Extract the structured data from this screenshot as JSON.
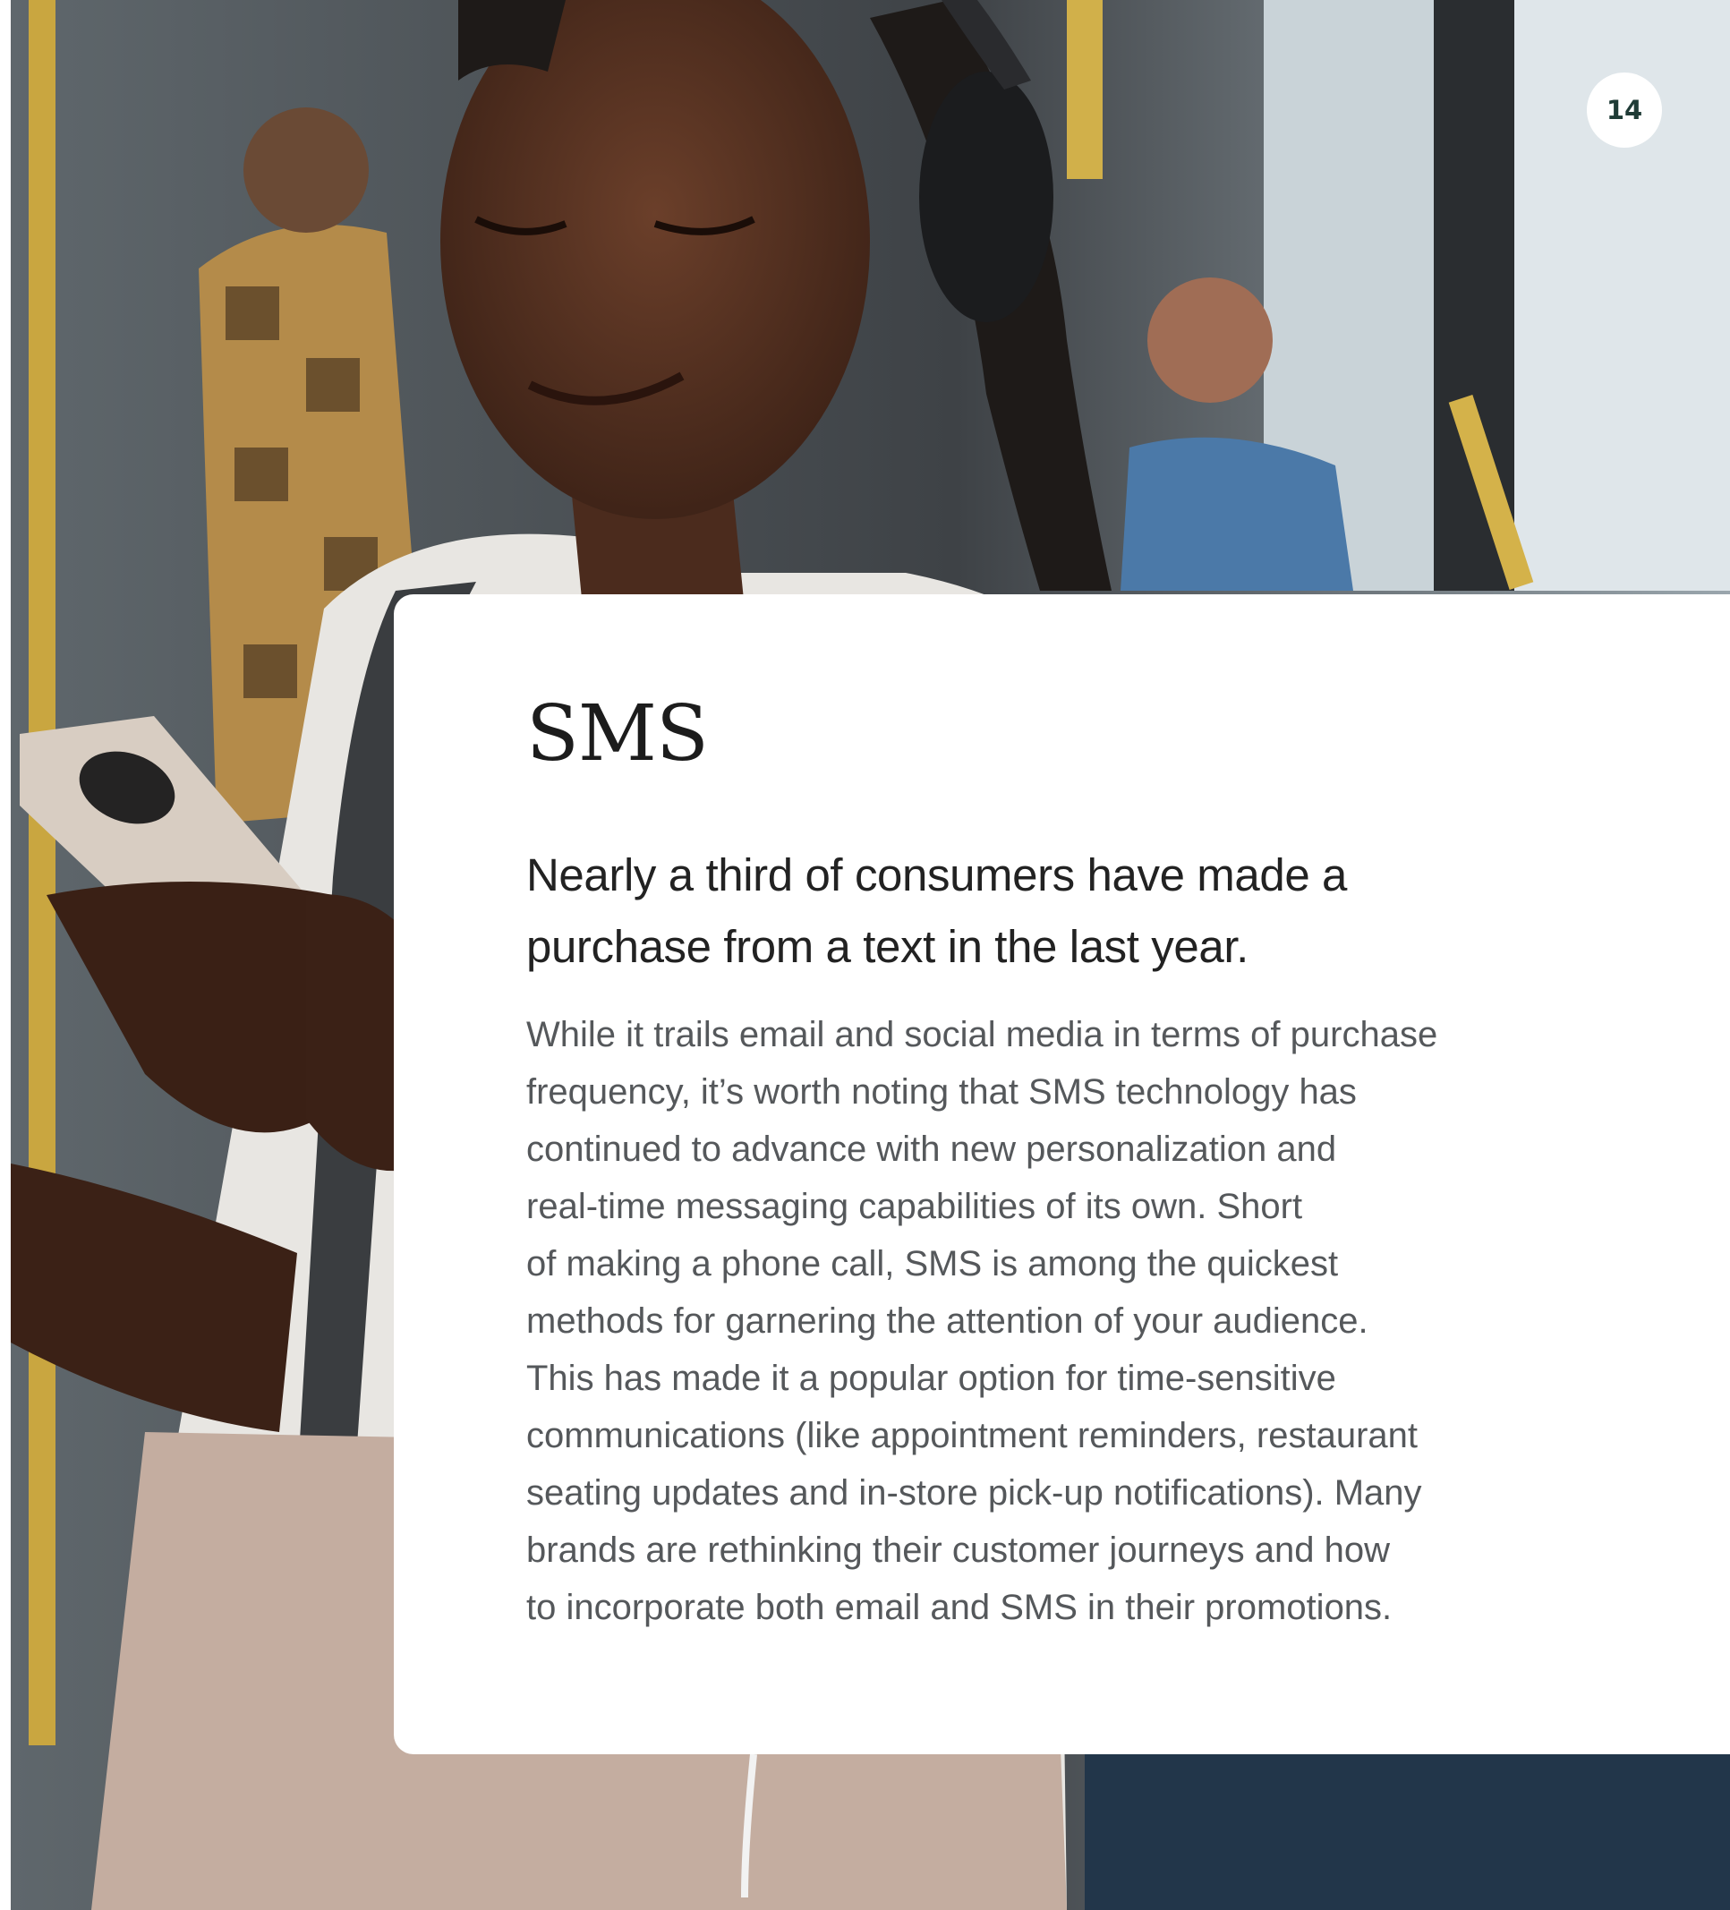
{
  "page": {
    "number": "14",
    "photo_description_icon": "woman-with-headphones-and-phone-photo"
  },
  "card": {
    "title": "SMS",
    "subtitle_lines": [
      "Nearly a third of consumers have made a",
      "purchase from a text in the last year."
    ],
    "body_lines": [
      "While it trails email and social media in terms of purchase",
      "frequency, it’s worth noting that SMS technology has",
      "continued to advance with new personalization and",
      "real-time messaging capabilities of its own. Short",
      "of making a phone call, SMS is among the quickest",
      "methods for garnering the attention of your audience.",
      "This has made it a popular option for time-sensitive",
      "communications (like appointment reminders, restaurant",
      "seating updates and in-store pick-up notifications). Many",
      "brands are rethinking their customer journeys and how",
      "to incorporate both email and SMS in their promotions."
    ]
  },
  "colors": {
    "page_number_text": "#1f3b36",
    "title": "#1c1c1c",
    "subtitle": "#222222",
    "body": "#55585b"
  }
}
